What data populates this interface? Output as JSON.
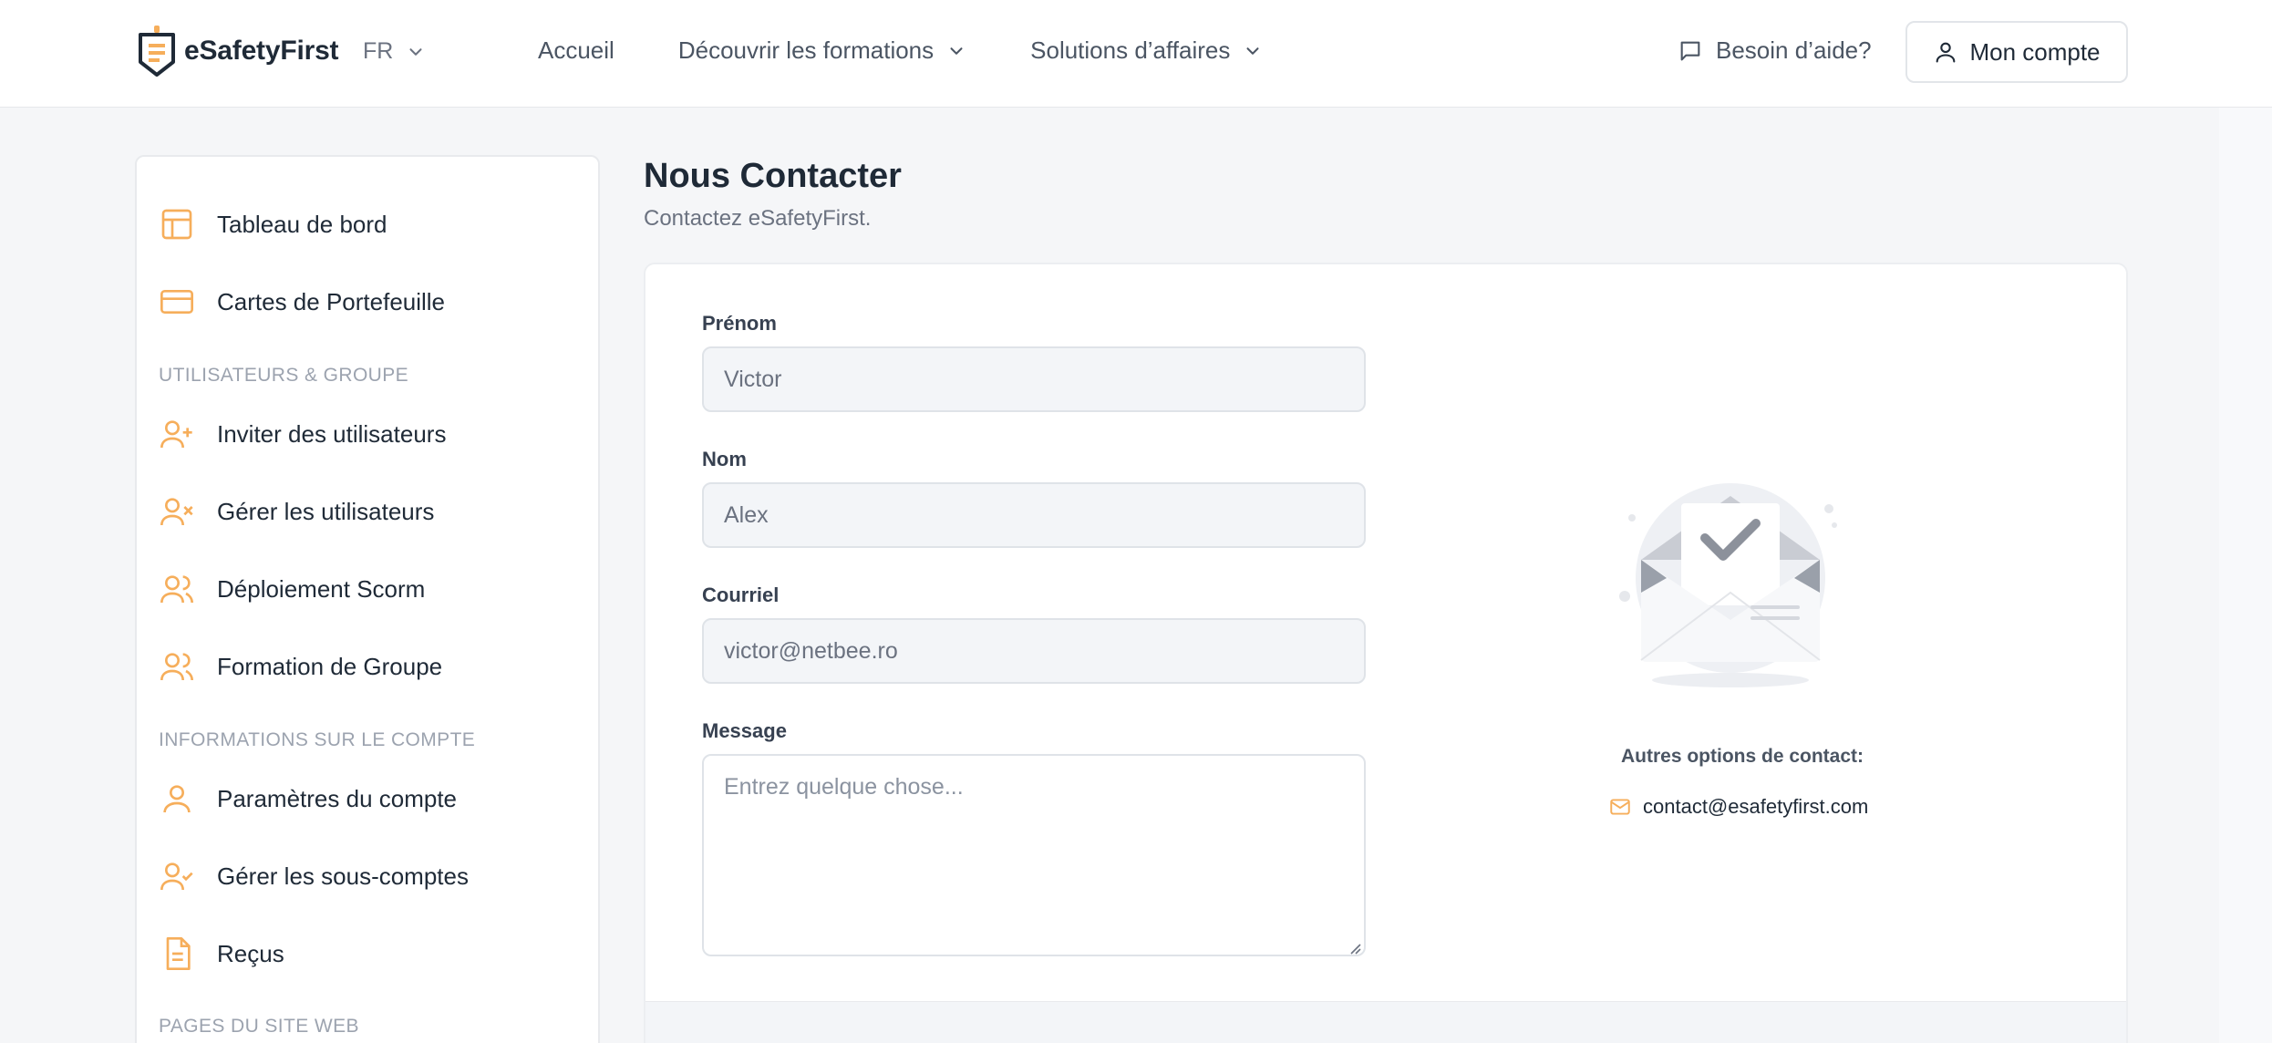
{
  "colors": {
    "accent": "#f6ae5b",
    "text": "#1f2a37",
    "muted": "#6b7280",
    "background": "#f5f6f8"
  },
  "header": {
    "brand": "eSafetyFirst",
    "language": "FR",
    "nav": [
      {
        "label": "Accueil",
        "has_dropdown": false
      },
      {
        "label": "Découvrir les formations",
        "has_dropdown": true
      },
      {
        "label": "Solutions d’affaires",
        "has_dropdown": true
      }
    ],
    "help_label": "Besoin d’aide?",
    "account_label": "Mon compte"
  },
  "sidebar": {
    "items": [
      {
        "label": "Tableau de bord",
        "icon": "layout-icon"
      },
      {
        "label": "Cartes de Portefeuille",
        "icon": "credit-card-icon"
      }
    ],
    "sections": [
      {
        "title": "UTILISATEURS & GROUPE",
        "items": [
          {
            "label": "Inviter des utilisateurs",
            "icon": "user-plus-icon"
          },
          {
            "label": "Gérer les utilisateurs",
            "icon": "user-x-icon"
          },
          {
            "label": "Déploiement Scorm",
            "icon": "users-icon"
          },
          {
            "label": "Formation de Groupe",
            "icon": "users-icon"
          }
        ]
      },
      {
        "title": "INFORMATIONS SUR LE COMPTE",
        "items": [
          {
            "label": "Paramètres du compte",
            "icon": "user-icon"
          },
          {
            "label": "Gérer les sous-comptes",
            "icon": "user-check-icon"
          },
          {
            "label": "Reçus",
            "icon": "document-icon"
          }
        ]
      },
      {
        "title": "PAGES DU SITE WEB",
        "items": []
      }
    ]
  },
  "main": {
    "title": "Nous Contacter",
    "subtitle": "Contactez eSafetyFirst.",
    "form": {
      "first_name": {
        "label": "Prénom",
        "value": "Victor"
      },
      "last_name": {
        "label": "Nom",
        "value": "Alex"
      },
      "email": {
        "label": "Courriel",
        "value": "victor@netbee.ro"
      },
      "message": {
        "label": "Message",
        "placeholder": "Entrez quelque chose..."
      }
    },
    "contact": {
      "heading": "Autres options de contact:",
      "email": "contact@esafetyfirst.com"
    }
  }
}
